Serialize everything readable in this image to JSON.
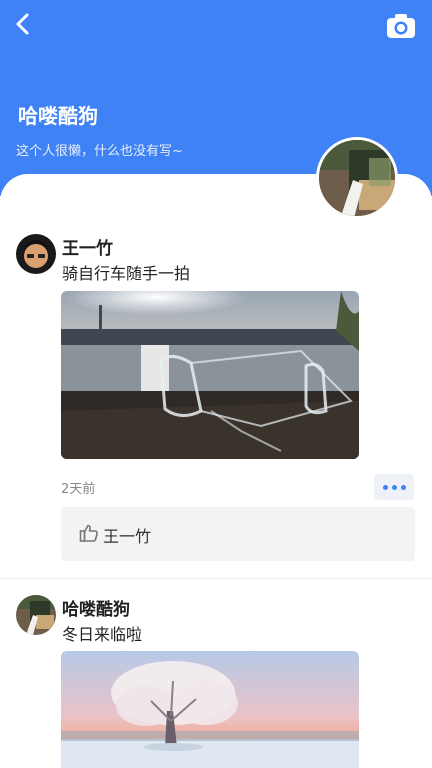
{
  "header": {
    "back_icon": "back-arrow-icon",
    "camera_icon": "camera-icon",
    "profile_name": "哈喽酷狗",
    "profile_bio": "这个人很懒，什么也没有写~",
    "background_color": "#3f82f5"
  },
  "feed": {
    "posts": [
      {
        "author": "王一竹",
        "text": "骑自行车随手一拍",
        "time": "2天前",
        "likes": [
          "王一竹"
        ]
      },
      {
        "author": "哈喽酷狗",
        "text": "冬日来临啦"
      }
    ]
  },
  "colors": {
    "accent": "#3f82f5",
    "like_box_bg": "#f3f3f5"
  }
}
